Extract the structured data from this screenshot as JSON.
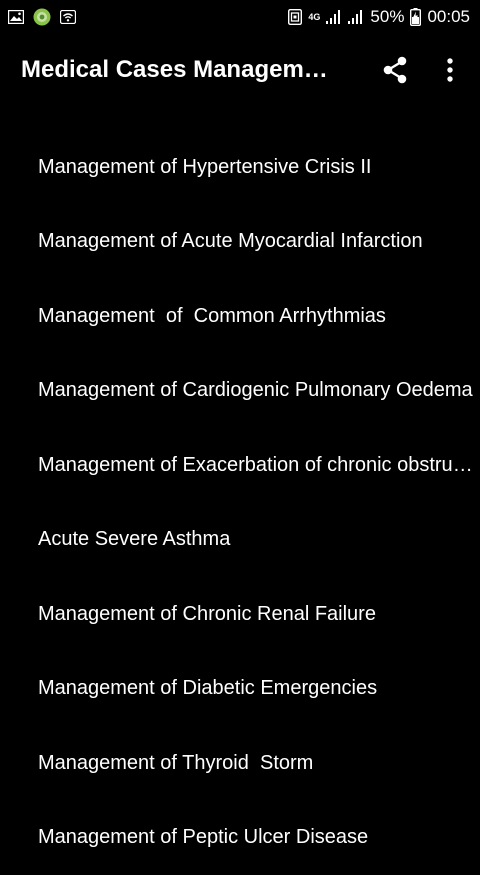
{
  "status_bar": {
    "network_type": "4G",
    "battery_percent": "50%",
    "time": "00:05"
  },
  "app_bar": {
    "title": "Medical Cases Managem…",
    "share_icon": "share-icon",
    "overflow_icon": "more-vert-icon"
  },
  "cases": [
    {
      "label": "Management of Hypertensive Crisis II"
    },
    {
      "label": "Management of Acute Myocardial Infarction"
    },
    {
      "label": "Management  of  Common Arrhythmias"
    },
    {
      "label": "Management of Cardiogenic Pulmonary Oedema"
    },
    {
      "label": "Management of Exacerbation of chronic obstructive pulmonary disease"
    },
    {
      "label": "Acute Severe Asthma"
    },
    {
      "label": "Management of Chronic Renal Failure"
    },
    {
      "label": "Management of Diabetic Emergencies"
    },
    {
      "label": "Management of Thyroid  Storm"
    },
    {
      "label": "Management of Peptic Ulcer Disease"
    }
  ],
  "colors": {
    "background": "#000000",
    "text": "#ffffff",
    "app_icon_green": "#8bc34a"
  }
}
